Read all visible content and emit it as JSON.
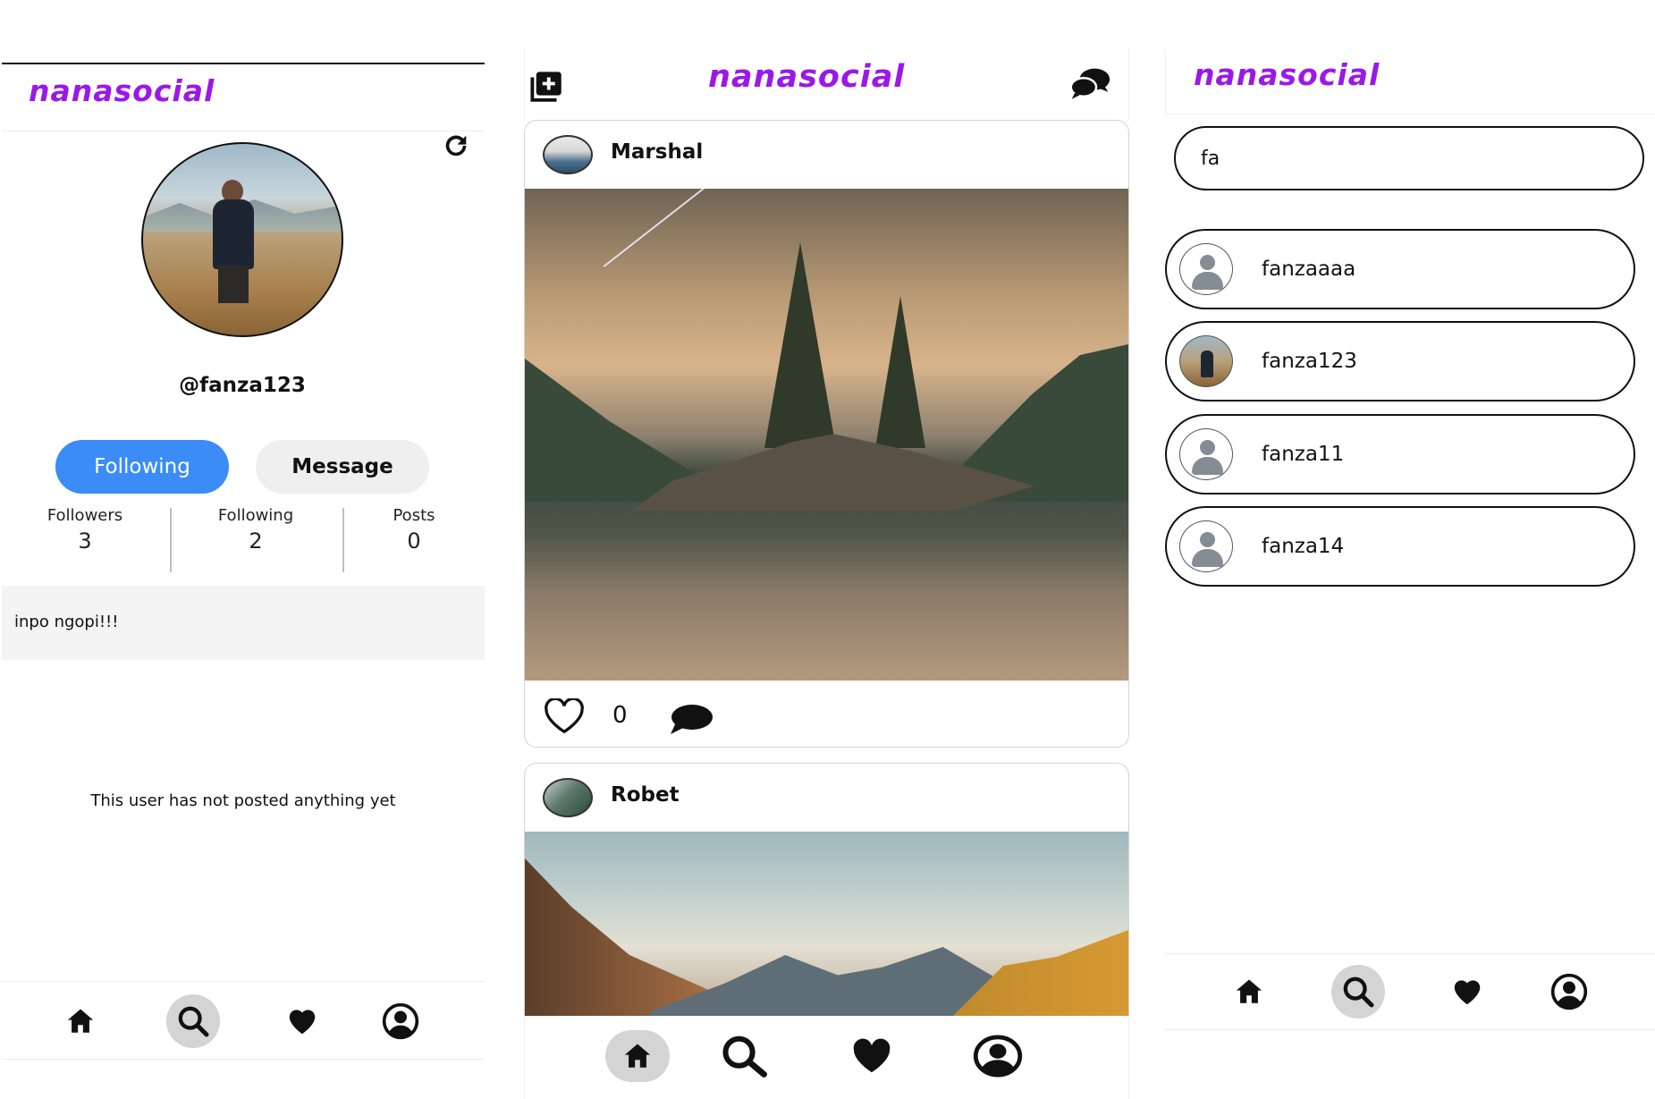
{
  "app": {
    "brand": "nanasocial",
    "brand_color": "#9b18e8"
  },
  "profile": {
    "username": "@fanza123",
    "following_button": "Following",
    "message_button": "Message",
    "stats": [
      {
        "label": "Followers",
        "value": "3"
      },
      {
        "label": "Following",
        "value": "2"
      },
      {
        "label": "Posts",
        "value": "0"
      }
    ],
    "bio": "inpo ngopi!!!",
    "empty_posts_text": "This user has not posted anything yet",
    "nav_active": "search"
  },
  "feed": {
    "posts": [
      {
        "author": "Marshal",
        "likes": "0"
      },
      {
        "author": "Robet"
      }
    ],
    "nav_active": "home"
  },
  "search": {
    "query": "fa",
    "results": [
      {
        "name": "fanzaaaa",
        "avatar": "generic"
      },
      {
        "name": "fanza123",
        "avatar": "photo"
      },
      {
        "name": "fanza11",
        "avatar": "generic"
      },
      {
        "name": "fanza14",
        "avatar": "generic"
      }
    ],
    "nav_active": "search"
  },
  "nav": {
    "items": [
      {
        "id": "home",
        "icon": "home-icon"
      },
      {
        "id": "search",
        "icon": "search-icon"
      },
      {
        "id": "likes",
        "icon": "heart-icon"
      },
      {
        "id": "profile",
        "icon": "profile-icon"
      }
    ]
  },
  "colors": {
    "primary_button": "#3b8cf6",
    "secondary_button": "#efefef",
    "nav_active_bg": "#d4d4d4"
  }
}
